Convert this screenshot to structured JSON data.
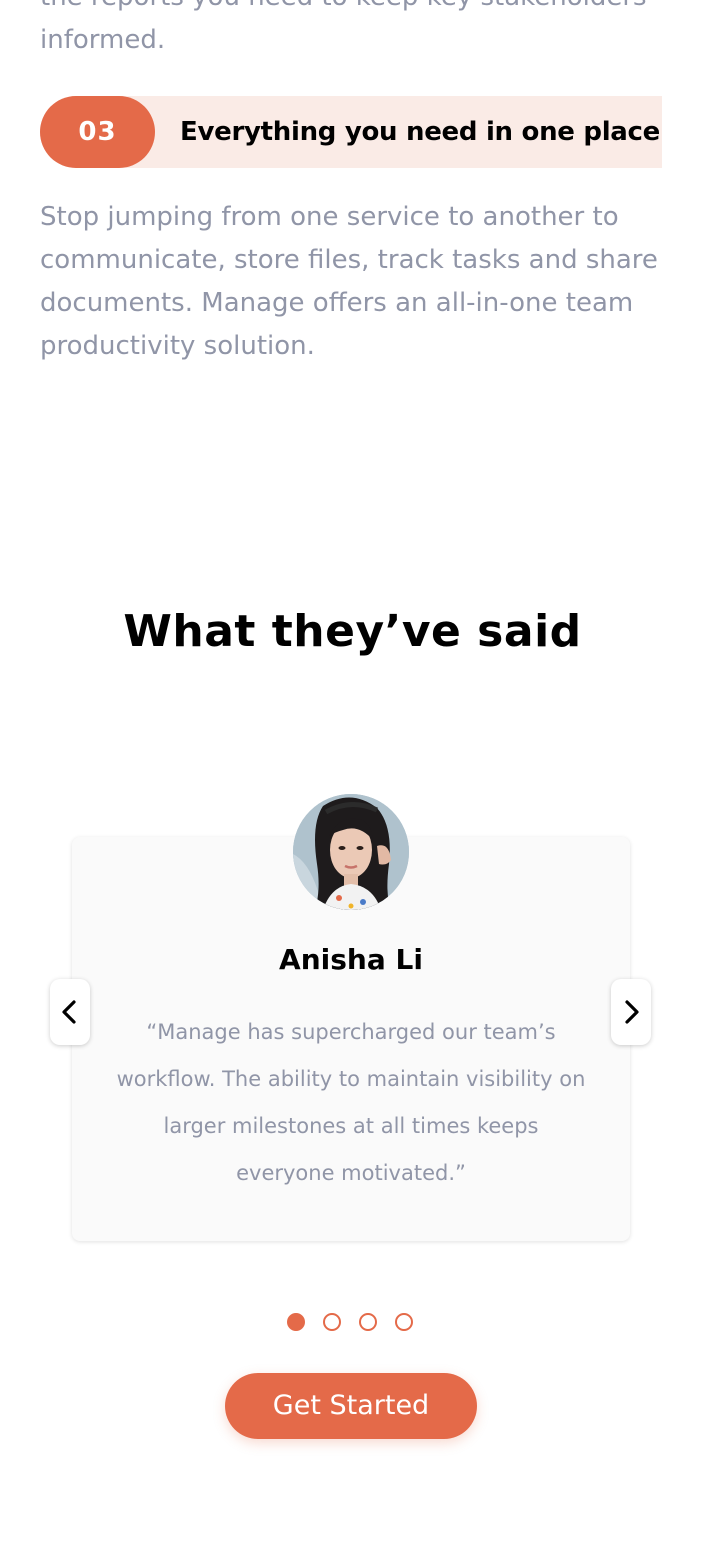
{
  "features": {
    "previous_desc_tail": "the reports you need to keep key stakeholders informed.",
    "item": {
      "number": "03",
      "title": "Everything you need in one place",
      "description": "Stop jumping from one service to another to communicate, store files, track tasks and share documents. Manage offers an all-in-one team productivity solution."
    }
  },
  "testimonials": {
    "heading": "What they’ve said",
    "active": {
      "name": "Anisha Li",
      "quote": "“Manage has supercharged our team’s workflow. The ability to maintain visibility on larger milestones at all times keeps everyone motivated.”"
    },
    "slide_count": 4,
    "active_index": 1,
    "prev_icon": "chevron-left-icon",
    "next_icon": "chevron-right-icon"
  },
  "cta": {
    "label": "Get Started"
  },
  "colors": {
    "accent": "#E46A49",
    "accent_tint": "#FAEBE6",
    "muted_text": "#9095A7",
    "heading_text": "#000000",
    "card_bg": "#FAFAFA"
  }
}
